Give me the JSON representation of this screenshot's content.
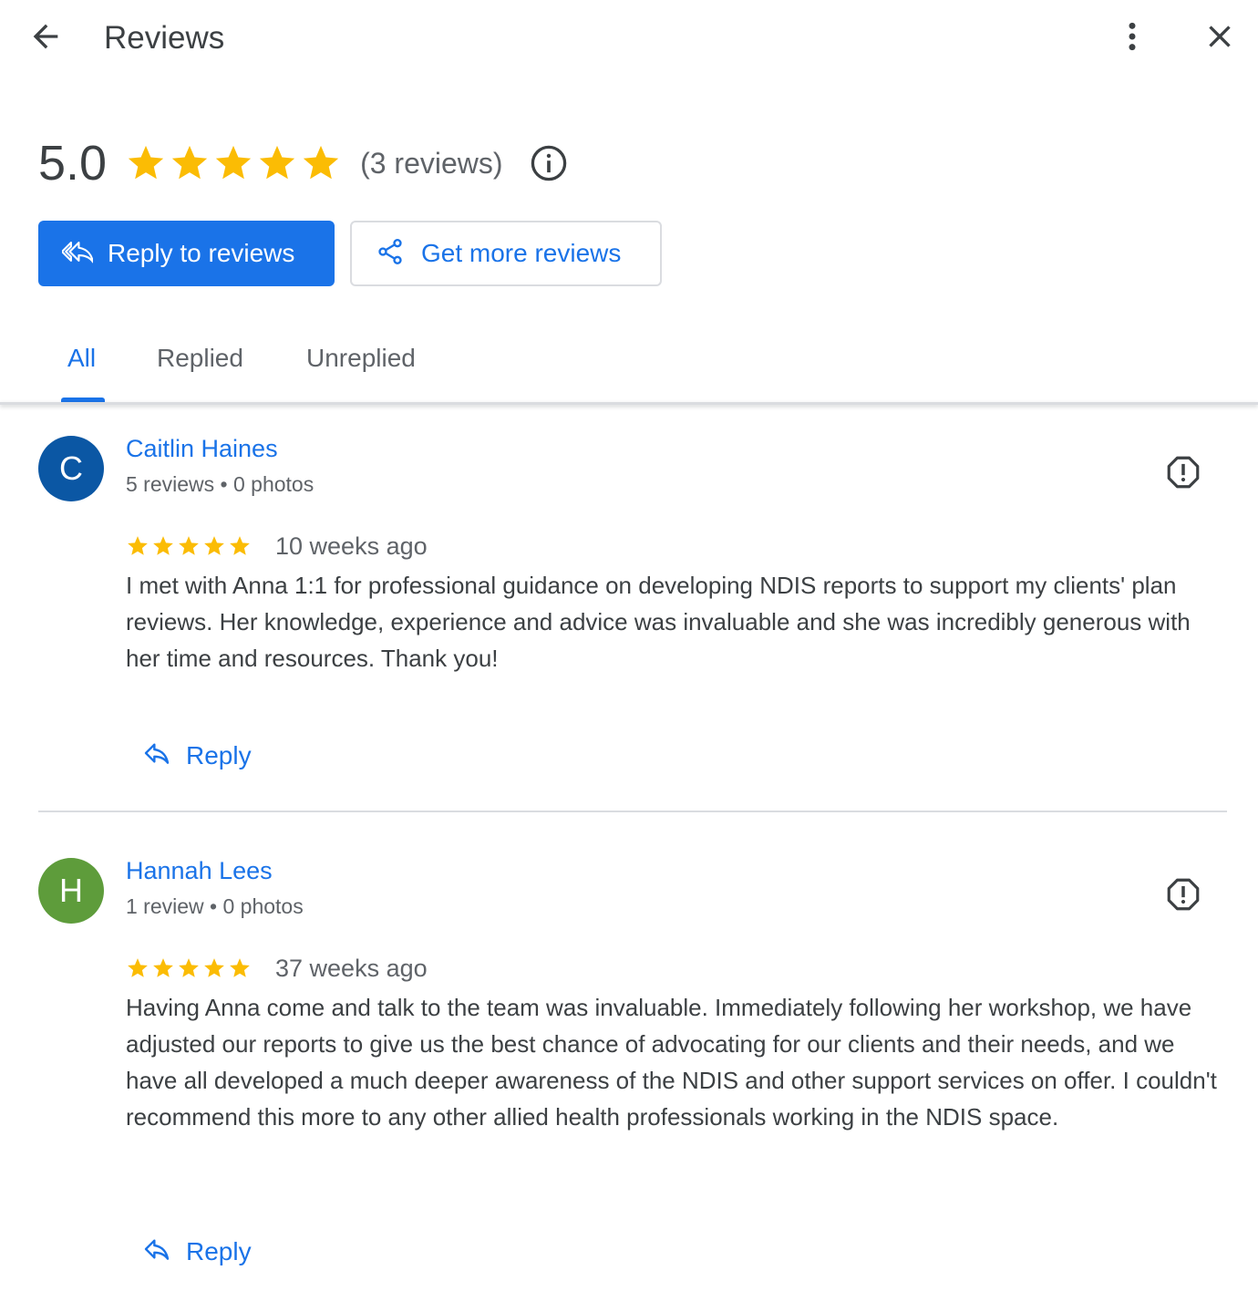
{
  "header": {
    "title": "Reviews",
    "back_icon": "arrow-left-icon",
    "more_icon": "more-vertical-icon",
    "close_icon": "close-icon"
  },
  "summary": {
    "rating": "5.0",
    "stars": 5,
    "review_count_text": "(3 reviews)",
    "info_icon": "info-icon",
    "star_color": "#fbbc04"
  },
  "actions": {
    "reply_to_reviews": "Reply to reviews",
    "get_more_reviews": "Get more reviews"
  },
  "tabs": [
    {
      "label": "All",
      "active": true
    },
    {
      "label": "Replied",
      "active": false
    },
    {
      "label": "Unreplied",
      "active": false
    }
  ],
  "reviews": [
    {
      "avatar_letter": "C",
      "avatar_color": "#0b57a4",
      "name": "Caitlin Haines",
      "meta": "5 reviews • 0 photos",
      "stars": 5,
      "date": "10 weeks ago",
      "text": "I met with Anna 1:1 for professional guidance on developing NDIS reports to support my clients' plan reviews. Her knowledge, experience and advice was invaluable and she was incredibly generous with her time and resources. Thank you!",
      "reply_label": "Reply"
    },
    {
      "avatar_letter": "H",
      "avatar_color": "#5e9c3b",
      "name": "Hannah Lees",
      "meta": "1 review • 0 photos",
      "stars": 5,
      "date": "37 weeks ago",
      "text": "Having Anna come and talk to the team was invaluable. Immediately following her workshop, we have adjusted our reports to give us the best chance of advocating for our clients and their needs, and we have all developed a much deeper awareness of the NDIS and other support services on offer. I couldn't recommend this more to any other allied health professionals working in the NDIS space.",
      "reply_label": "Reply"
    }
  ],
  "colors": {
    "accent": "#1a73e8",
    "text_secondary": "#5f6368",
    "divider": "#dadce0"
  }
}
